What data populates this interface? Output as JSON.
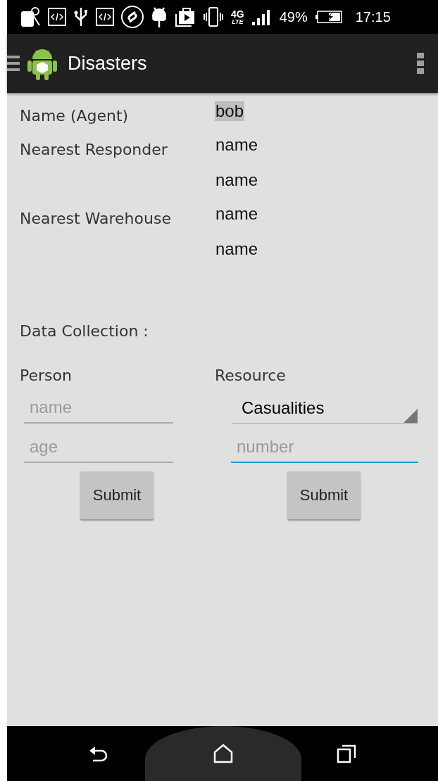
{
  "status_bar": {
    "network": "4G",
    "network_sub": "LTE",
    "battery": "49%",
    "time": "17:15"
  },
  "toolbar": {
    "title": "Disasters"
  },
  "info": [
    {
      "label": "Name (Agent)",
      "values": [
        {
          "text": "bob",
          "selected": true
        }
      ]
    },
    {
      "label": "Nearest Responder",
      "values": [
        {
          "text": "name",
          "selected": false
        },
        {
          "text": "name",
          "selected": false
        }
      ]
    },
    {
      "label": "Nearest Warehouse",
      "values": [
        {
          "text": "name",
          "selected": false
        },
        {
          "text": "name",
          "selected": false
        }
      ]
    }
  ],
  "section_title": "Data Collection :",
  "person": {
    "heading": "Person",
    "fields": [
      {
        "placeholder": "name",
        "focused": false
      },
      {
        "placeholder": "age",
        "focused": false
      }
    ],
    "button": "Submit"
  },
  "resource": {
    "heading": "Resource",
    "dropdown": "Casualities",
    "fields": [
      {
        "placeholder": "number",
        "focused": true
      }
    ],
    "button": "Submit"
  }
}
